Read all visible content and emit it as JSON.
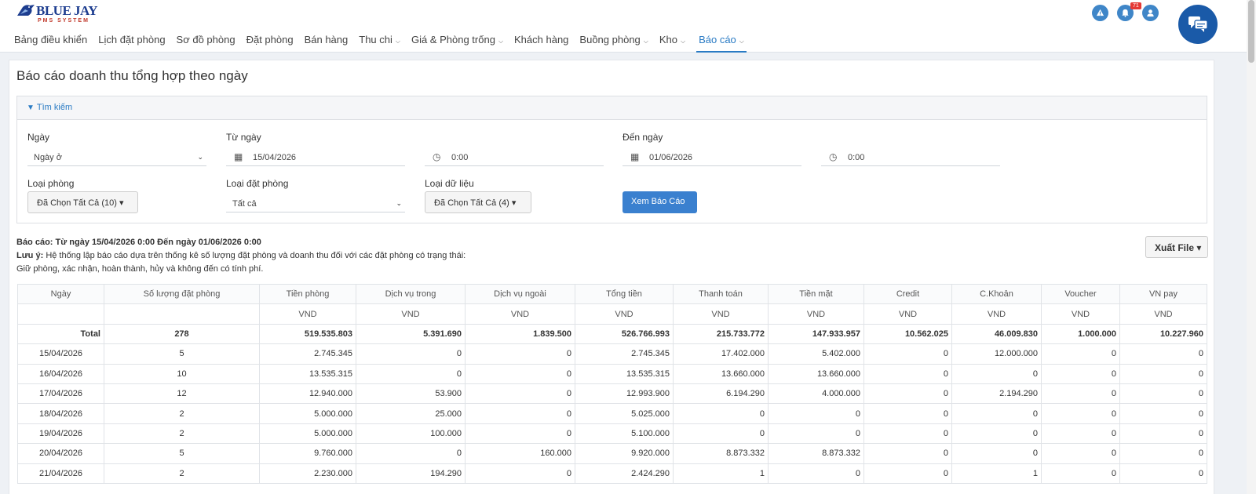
{
  "app": {
    "logo_brand": "BLUE JAY",
    "logo_sub": "PMS SYSTEM",
    "notification_count": "71"
  },
  "nav": [
    {
      "label": "Bảng điều khiển",
      "has_dropdown": false
    },
    {
      "label": "Lịch đặt phòng",
      "has_dropdown": false
    },
    {
      "label": "Sơ đồ phòng",
      "has_dropdown": false
    },
    {
      "label": "Đặt phòng",
      "has_dropdown": false
    },
    {
      "label": "Bán hàng",
      "has_dropdown": false
    },
    {
      "label": "Thu chi",
      "has_dropdown": true
    },
    {
      "label": "Giá & Phòng trống",
      "has_dropdown": true
    },
    {
      "label": "Khách hàng",
      "has_dropdown": false
    },
    {
      "label": "Buồng phòng",
      "has_dropdown": true
    },
    {
      "label": "Kho",
      "has_dropdown": true
    },
    {
      "label": "Báo cáo",
      "has_dropdown": true,
      "active": true
    }
  ],
  "page": {
    "title": "Báo cáo doanh thu tổng hợp theo ngày"
  },
  "search": {
    "header": "Tìm kiếm",
    "date_label": "Ngày",
    "date_value": "Ngày ở",
    "from_label": "Từ ngày",
    "from_date": "15/04/2026",
    "from_time": "0:00",
    "to_label": "Đến ngày",
    "to_date": "01/06/2026",
    "to_time": "0:00",
    "room_type_label": "Loại phòng",
    "room_type_value": "Đã Chọn Tất Cả (10)",
    "booking_type_label": "Loại đặt phòng",
    "booking_type_value": "Tất cả",
    "data_type_label": "Loại dữ liệu",
    "data_type_value": "Đã Chọn Tất Cả (4)",
    "view_button": "Xem Báo Cáo"
  },
  "report": {
    "range_label": "Báo cáo:",
    "range_text": "Từ ngày 15/04/2026 0:00 Đến ngày 01/06/2026 0:00",
    "note_label": "Lưu ý:",
    "note_text": "Hệ thống lập báo cáo dựa trên thống kê số lượng đặt phòng và doanh thu đối với các đặt phòng có trạng thái:",
    "note_text2": "Giữ phòng, xác nhận, hoàn thành, hủy và không đến có tính phí.",
    "export_button": "Xuất File"
  },
  "table": {
    "headers": [
      "Ngày",
      "Số lượng đặt phòng",
      "Tiền phòng",
      "Dịch vụ trong",
      "Dịch vụ ngoài",
      "Tổng tiền",
      "Thanh toán",
      "Tiền mặt",
      "Credit",
      "C.Khoản",
      "Voucher",
      "VN pay"
    ],
    "units": [
      "",
      "",
      "VND",
      "VND",
      "VND",
      "VND",
      "VND",
      "VND",
      "VND",
      "VND",
      "VND",
      "VND"
    ],
    "total": [
      "Total",
      "278",
      "519.535.803",
      "5.391.690",
      "1.839.500",
      "526.766.993",
      "215.733.772",
      "147.933.957",
      "10.562.025",
      "46.009.830",
      "1.000.000",
      "10.227.960"
    ],
    "rows": [
      [
        "15/04/2026",
        "5",
        "2.745.345",
        "0",
        "0",
        "2.745.345",
        "17.402.000",
        "5.402.000",
        "0",
        "12.000.000",
        "0",
        "0"
      ],
      [
        "16/04/2026",
        "10",
        "13.535.315",
        "0",
        "0",
        "13.535.315",
        "13.660.000",
        "13.660.000",
        "0",
        "0",
        "0",
        "0"
      ],
      [
        "17/04/2026",
        "12",
        "12.940.000",
        "53.900",
        "0",
        "12.993.900",
        "6.194.290",
        "4.000.000",
        "0",
        "2.194.290",
        "0",
        "0"
      ],
      [
        "18/04/2026",
        "2",
        "5.000.000",
        "25.000",
        "0",
        "5.025.000",
        "0",
        "0",
        "0",
        "0",
        "0",
        "0"
      ],
      [
        "19/04/2026",
        "2",
        "5.000.000",
        "100.000",
        "0",
        "5.100.000",
        "0",
        "0",
        "0",
        "0",
        "0",
        "0"
      ],
      [
        "20/04/2026",
        "5",
        "9.760.000",
        "0",
        "160.000",
        "9.920.000",
        "8.873.332",
        "8.873.332",
        "0",
        "0",
        "0",
        "0"
      ],
      [
        "21/04/2026",
        "2",
        "2.230.000",
        "194.290",
        "0",
        "2.424.290",
        "1",
        "0",
        "0",
        "1",
        "0",
        "0"
      ]
    ]
  }
}
